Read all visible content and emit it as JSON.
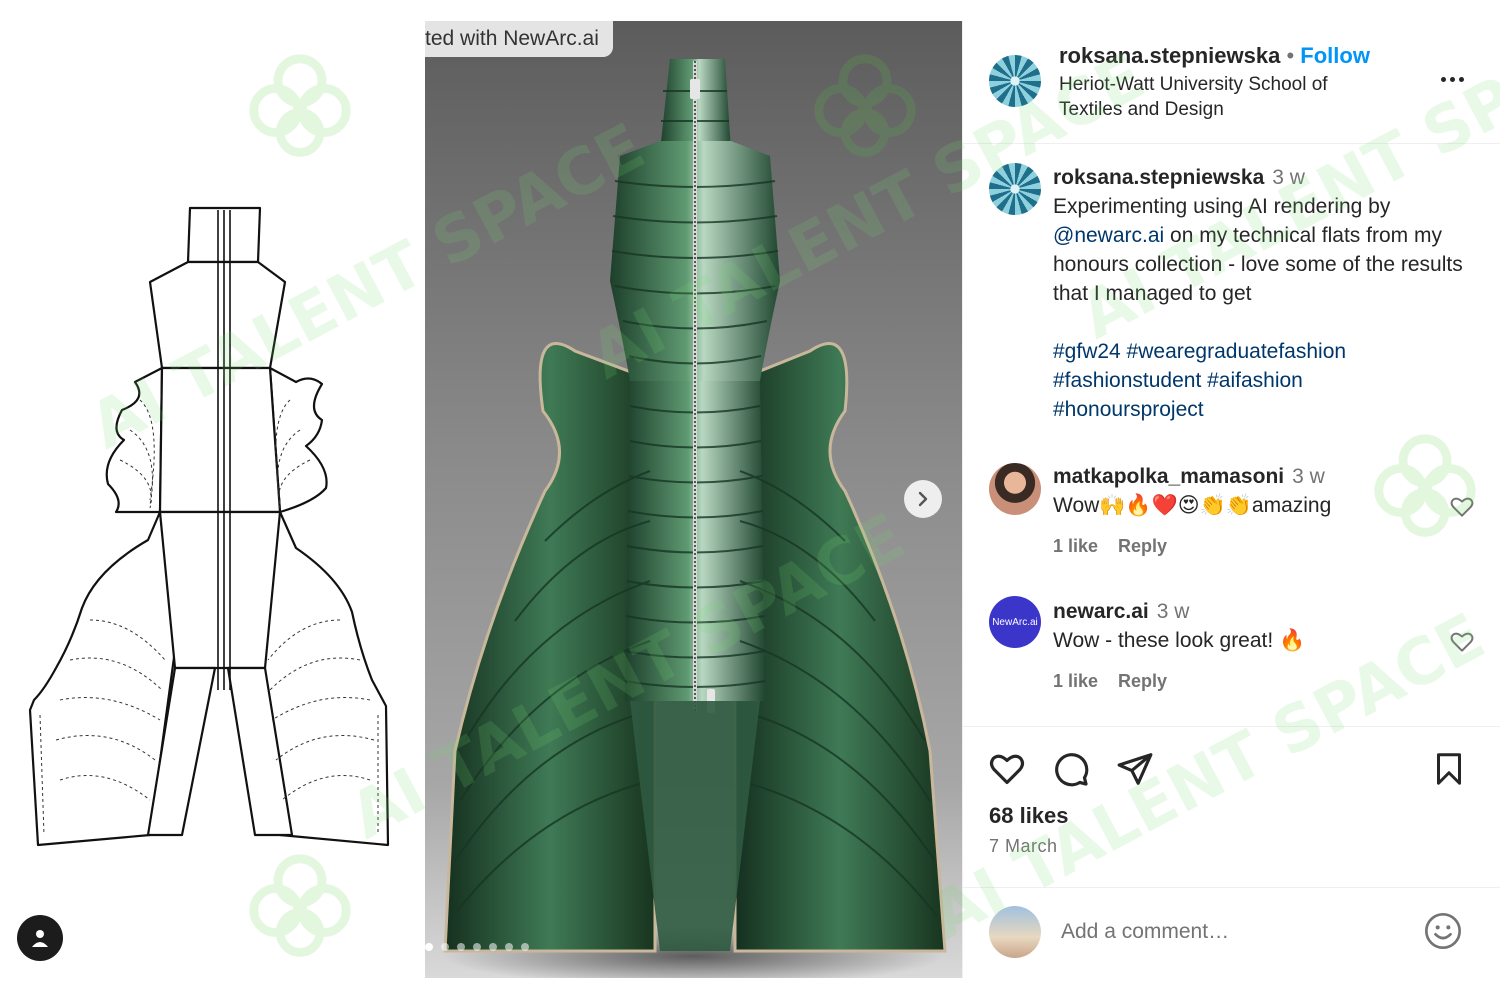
{
  "photo": {
    "label": "ted with NewArc.ai",
    "carousel_count": 7,
    "carousel_active": 1
  },
  "header": {
    "username": "roksana.stepniewska",
    "separator": "•",
    "follow_label": "Follow",
    "location": "Heriot-Watt University School of Textiles and Design"
  },
  "caption": {
    "username": "roksana.stepniewska",
    "time": "3 w",
    "text_before": "Experimenting using AI rendering by ",
    "mention": "@newarc.ai",
    "text_after": " on my technical flats from my honours collection - love some of the results that I managed to get",
    "hashtags_line1": "#gfw24 #wearegraduatefashion",
    "hashtags_line2": "#fashionstudent #aifashion",
    "hashtags_line3": "#honoursproject"
  },
  "comments": [
    {
      "username": "matkapolka_mamasoni",
      "time": "3 w",
      "text": "Wow🙌🔥❤️😍👏👏amazing",
      "likes": "1 like",
      "reply": "Reply"
    },
    {
      "username": "newarc.ai",
      "avatar_text": "NewArc.ai",
      "time": "3 w",
      "text": "Wow - these look great! 🔥",
      "likes": "1 like",
      "reply": "Reply"
    }
  ],
  "footer": {
    "likes": "68 likes",
    "date": "7 March",
    "add_comment_placeholder": "Add a comment…"
  },
  "watermark": {
    "text": "AI TALENT SPACE"
  },
  "icons": [
    "like-icon",
    "comment-icon",
    "share-icon",
    "save-icon",
    "emoji-icon",
    "more-icon",
    "chevron-right-icon",
    "user-icon",
    "heart-icon"
  ],
  "colors": {
    "follow": "#0095f6",
    "link": "#00376b",
    "secondary_text": "#737373",
    "jacket_green": "#2f6a45"
  }
}
